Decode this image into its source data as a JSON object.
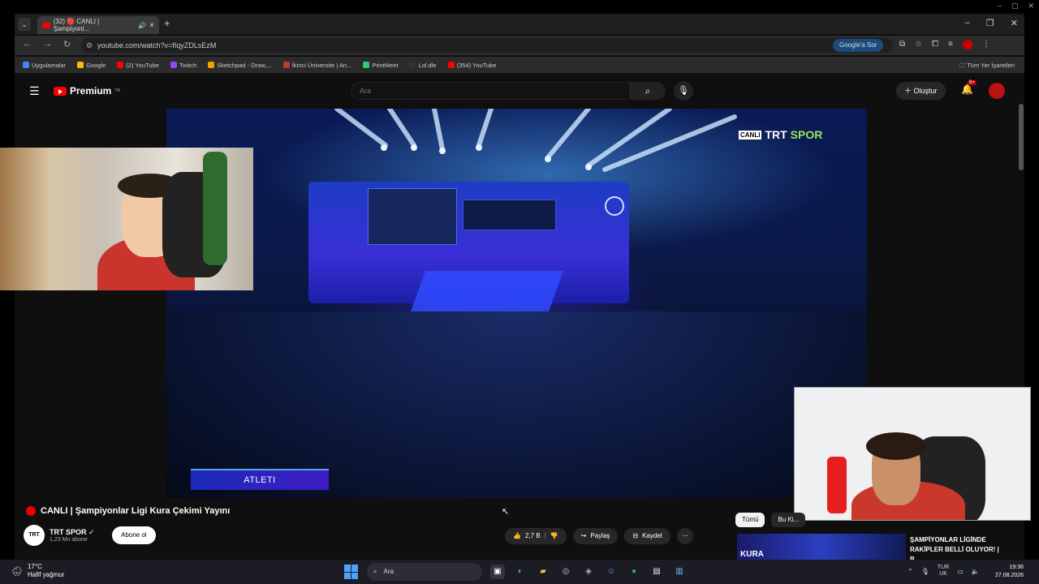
{
  "browser": {
    "tab_title": "(32) 🔴 CANLI | Şampiyonl...",
    "url": "youtube.com/watch?v=fIqyZDLsEzM",
    "google_sor": "Google'a Sor",
    "bookmarks": [
      {
        "label": "Uygulamalar",
        "color": "#4285f4"
      },
      {
        "label": "Google",
        "color": "#fbbc05"
      },
      {
        "label": "(2) YouTube",
        "color": "#ff0000"
      },
      {
        "label": "Twitch",
        "color": "#9146ff"
      },
      {
        "label": "Sketchpad - Draw,...",
        "color": "#f4a100"
      },
      {
        "label": "İkinci Üniversite | An...",
        "color": "#c0392b"
      },
      {
        "label": "PrintMeet",
        "color": "#2ecc71"
      },
      {
        "label": "Lol.dle",
        "color": "#333333"
      },
      {
        "label": "(354) YouTube",
        "color": "#ff0000"
      }
    ],
    "all_bookmarks": "Tüm Yer İşaretleri"
  },
  "youtube": {
    "logo_text": "Premium",
    "logo_sup": "TR",
    "search_placeholder": "Ara",
    "create_label": "Oluştur",
    "notif_badge": "9+"
  },
  "video": {
    "broadcaster_live": "CANLI",
    "broadcaster_trt": "TRT",
    "broadcaster_spor": "SPOR",
    "lower_third": "ATLETI",
    "title": "CANLI | Şampiyonlar Ligi Kura Çekimi Yayını",
    "channel_name": "TRT SPOR",
    "channel_logo": "TRT",
    "channel_subs": "1,23 Mn abone",
    "subscribe": "Abone ol",
    "likes": "2,7 B",
    "share": "Paylaş",
    "save": "Kaydet",
    "more": "⋯"
  },
  "sidebar": {
    "chips": [
      "Tümü",
      "Bu Ki..."
    ],
    "rec_thumb_text": "KURA",
    "rec_title": "ŞAMPİYONLAR LİGİNDE RAKİPLER BELLİ OLUYOR! | B..."
  },
  "taskbar": {
    "temp": "17°C",
    "weather": "Hafif yağmur",
    "search": "Ara",
    "lang_top": "TUR",
    "lang_bottom": "UK",
    "time": "19:36",
    "date": "27.08.2026"
  }
}
